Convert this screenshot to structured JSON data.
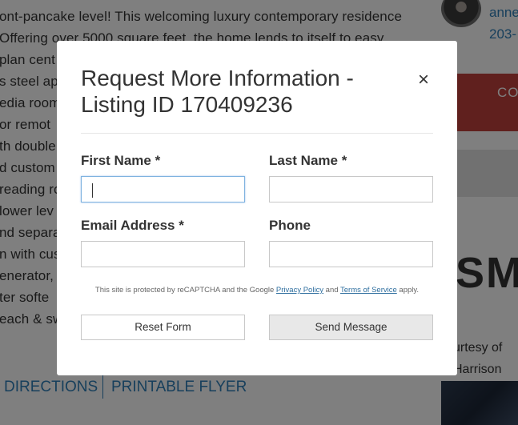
{
  "background": {
    "paragraph_lines": [
      "ont-pancake level! This welcoming luxury contemporary residence",
      "Offering over 5000 square feet, the home lends to itself to easy",
      "plan cent",
      "s steel app",
      "edia room",
      "or remot",
      "th double",
      "d custom",
      "reading ro",
      "lower lev",
      "nd separa",
      "n with cus",
      "enerator,",
      "ter softe",
      "each & sw"
    ],
    "agent_name": "anne",
    "agent_phone": "203-",
    "red_block_text": "CO",
    "logo_text": "SM",
    "courtesy_line1": "urtesy of",
    "courtesy_line2": "Harrison",
    "link_directions": "DIRECTIONS",
    "link_flyer": "PRINTABLE FLYER"
  },
  "modal": {
    "title": "Request More Information - Listing ID 170409236",
    "close_icon": "×",
    "fields": {
      "first_name": {
        "label": "First Name *",
        "value": ""
      },
      "last_name": {
        "label": "Last Name *",
        "value": ""
      },
      "email": {
        "label": "Email Address *",
        "value": ""
      },
      "phone": {
        "label": "Phone",
        "value": ""
      }
    },
    "recaptcha": {
      "prefix": "This site is protected by reCAPTCHA and the Google ",
      "privacy_link": "Privacy Policy",
      "and": " and ",
      "terms_link": "Terms of Service",
      "suffix": " apply."
    },
    "buttons": {
      "reset": "Reset Form",
      "send": "Send Message"
    }
  },
  "colors": {
    "link_blue": "#2f7fb8",
    "accent_red": "#c0413c",
    "overlay": "rgba(0,0,0,0.5)"
  }
}
